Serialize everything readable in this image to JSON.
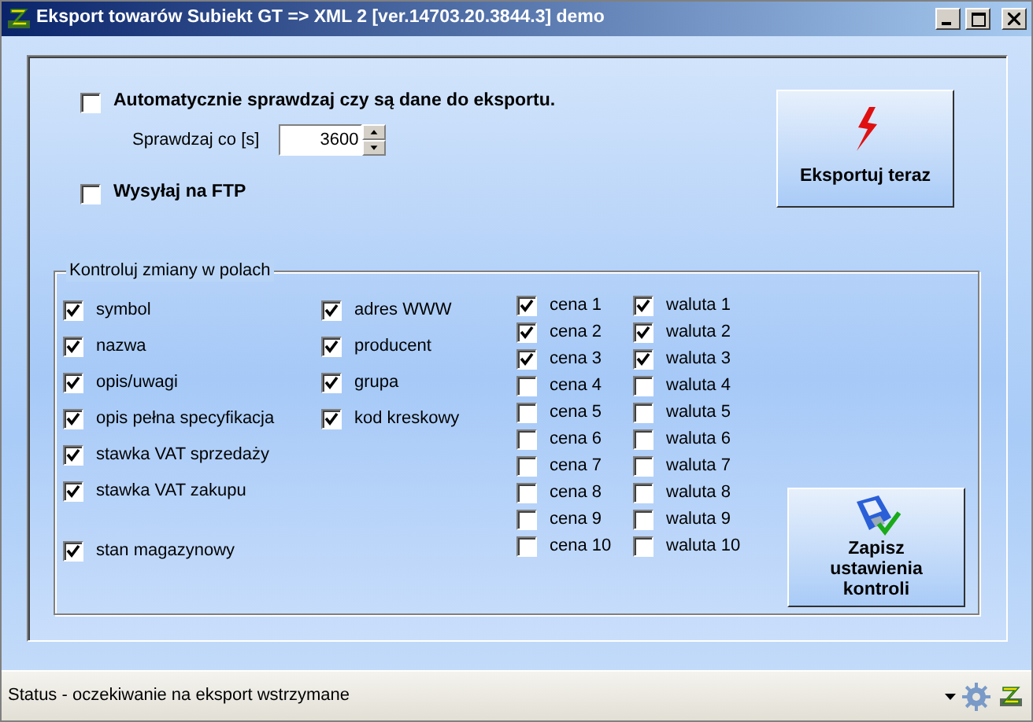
{
  "window": {
    "title": "Eksport towarów Subiekt GT => XML 2 [ver.14703.20.3844.3] demo"
  },
  "auto_check": {
    "label": "Automatycznie sprawdzaj czy są dane do eksportu.",
    "checked": false
  },
  "interval": {
    "label": "Sprawdzaj co [s]",
    "value": "3600"
  },
  "ftp": {
    "label": "Wysyłaj na FTP",
    "checked": false
  },
  "export_button": {
    "label": "Eksportuj teraz"
  },
  "fields_group": {
    "title": "Kontroluj zmiany w polach",
    "columns": [
      {
        "kind": "wide",
        "items": [
          {
            "label": "symbol",
            "checked": true,
            "separated": false
          },
          {
            "label": "nazwa",
            "checked": true,
            "separated": false
          },
          {
            "label": "opis/uwagi",
            "checked": true,
            "separated": false
          },
          {
            "label": "opis pełna specyfikacja",
            "checked": true,
            "separated": false
          },
          {
            "label": "stawka VAT sprzedaży",
            "checked": true,
            "separated": false
          },
          {
            "label": "stawka VAT zakupu",
            "checked": true,
            "separated": false
          },
          {
            "label": "stan magazynowy",
            "checked": true,
            "separated": true
          }
        ]
      },
      {
        "kind": "wide",
        "items": [
          {
            "label": "adres WWW",
            "checked": true,
            "separated": false
          },
          {
            "label": "producent",
            "checked": true,
            "separated": false
          },
          {
            "label": "grupa",
            "checked": true,
            "separated": false
          },
          {
            "label": "kod kreskowy",
            "checked": true,
            "separated": false
          }
        ]
      },
      {
        "kind": "compact",
        "items": [
          {
            "label": "cena 1",
            "checked": true,
            "separated": false
          },
          {
            "label": "cena 2",
            "checked": true,
            "separated": false
          },
          {
            "label": "cena 3",
            "checked": true,
            "separated": false
          },
          {
            "label": "cena 4",
            "checked": false,
            "separated": false
          },
          {
            "label": "cena 5",
            "checked": false,
            "separated": false
          },
          {
            "label": "cena 6",
            "checked": false,
            "separated": false
          },
          {
            "label": "cena 7",
            "checked": false,
            "separated": false
          },
          {
            "label": "cena 8",
            "checked": false,
            "separated": false
          },
          {
            "label": "cena 9",
            "checked": false,
            "separated": false
          },
          {
            "label": "cena 10",
            "checked": false,
            "separated": false
          }
        ]
      },
      {
        "kind": "compact",
        "items": [
          {
            "label": "waluta 1",
            "checked": true,
            "separated": false
          },
          {
            "label": "waluta 2",
            "checked": true,
            "separated": false
          },
          {
            "label": "waluta 3",
            "checked": true,
            "separated": false
          },
          {
            "label": "waluta 4",
            "checked": false,
            "separated": false
          },
          {
            "label": "waluta 5",
            "checked": false,
            "separated": false
          },
          {
            "label": "waluta 6",
            "checked": false,
            "separated": false
          },
          {
            "label": "waluta 7",
            "checked": false,
            "separated": false
          },
          {
            "label": "waluta 8",
            "checked": false,
            "separated": false
          },
          {
            "label": "waluta 9",
            "checked": false,
            "separated": false
          },
          {
            "label": "waluta 10",
            "checked": false,
            "separated": false
          }
        ]
      }
    ]
  },
  "save_button": {
    "label": "Zapisz ustawienia kontroli"
  },
  "status_bar": {
    "text": "Status  - oczekiwanie na eksport wstrzymane"
  }
}
